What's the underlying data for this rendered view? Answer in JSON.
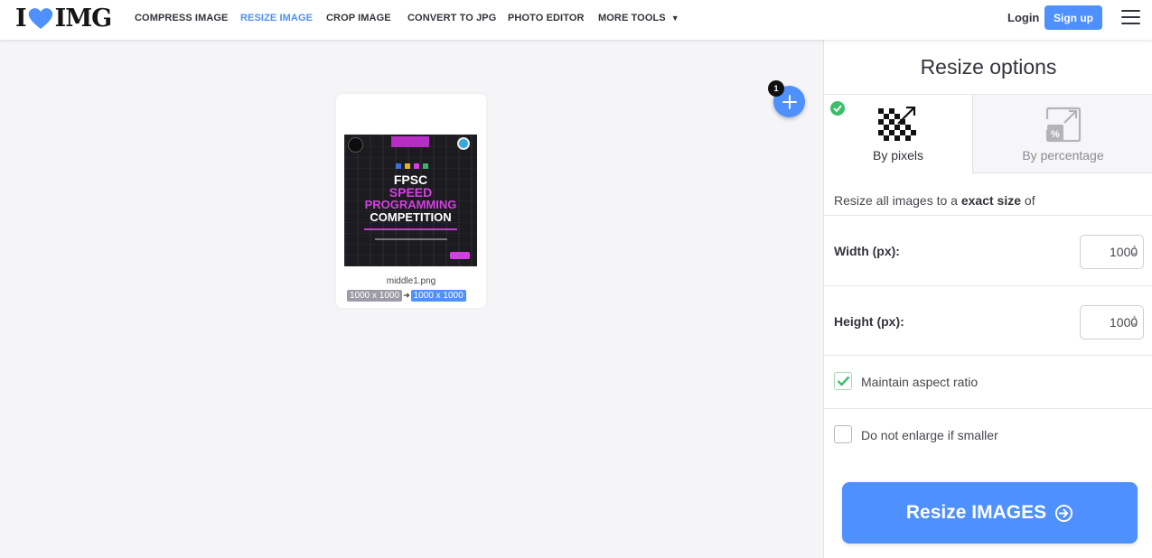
{
  "header": {
    "logo_left": "I",
    "logo_right": "IMG",
    "nav": [
      {
        "label": "COMPRESS IMAGE"
      },
      {
        "label": "RESIZE IMAGE"
      },
      {
        "label": "CROP IMAGE"
      },
      {
        "label": "CONVERT TO JPG"
      },
      {
        "label": "PHOTO EDITOR"
      },
      {
        "label": "MORE TOOLS"
      }
    ],
    "login": "Login",
    "signup": "Sign up"
  },
  "workspace": {
    "file": {
      "name": "middle1.png",
      "original_size": "1000 x 1000",
      "new_size": "1000 x 1000",
      "thumbnail_text": {
        "line1": "FPSC",
        "line2": "SPEED",
        "line3": "PROGRAMMING",
        "line4": "COMPETITION"
      }
    },
    "file_count": "1"
  },
  "sidebar": {
    "title": "Resize options",
    "tabs": [
      {
        "label": "By pixels",
        "selected": true
      },
      {
        "label": "By percentage",
        "selected": false
      }
    ],
    "description_prefix": "Resize all images to a ",
    "description_bold": "exact size",
    "description_suffix": " of",
    "width_label": "Width (px):",
    "width_value": "1000",
    "height_label": "Height (px):",
    "height_value": "1000",
    "maintain_aspect_label": "Maintain aspect ratio",
    "maintain_aspect_checked": true,
    "no_enlarge_label": "Do not enlarge if smaller",
    "no_enlarge_checked": false,
    "submit_label": "Resize IMAGES"
  },
  "colors": {
    "accent": "#4d90fe",
    "success": "#3ebd6c",
    "text": "#33333b"
  }
}
